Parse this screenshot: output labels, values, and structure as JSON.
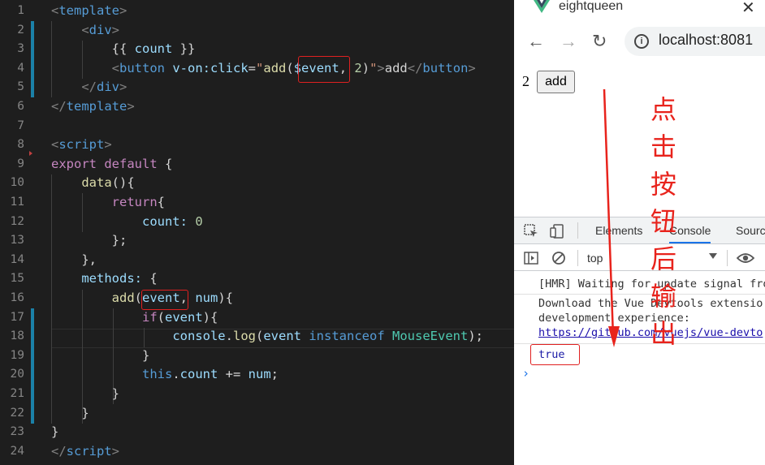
{
  "editor": {
    "line_numbers": [
      "1",
      "2",
      "3",
      "4",
      "5",
      "6",
      "7",
      "8",
      "9",
      "10",
      "11",
      "12",
      "13",
      "14",
      "15",
      "16",
      "17",
      "18",
      "19",
      "20",
      "21",
      "22",
      "23",
      "24"
    ],
    "lines": [
      [
        [
          "t-gray",
          "<"
        ],
        [
          "t-tag",
          "template"
        ],
        [
          "t-gray",
          ">"
        ]
      ],
      [
        [
          "t-pl",
          "    "
        ],
        [
          "t-gray",
          "<"
        ],
        [
          "t-tag",
          "div"
        ],
        [
          "t-gray",
          ">"
        ]
      ],
      [
        [
          "t-pl",
          "        {{ "
        ],
        [
          "t-var",
          "count"
        ],
        [
          "t-pl",
          " }}"
        ]
      ],
      [
        [
          "t-pl",
          "        "
        ],
        [
          "t-gray",
          "<"
        ],
        [
          "t-tag",
          "button"
        ],
        [
          "t-pl",
          " "
        ],
        [
          "t-attr",
          "v-on:click"
        ],
        [
          "t-pl",
          "="
        ],
        [
          "t-str",
          "\""
        ],
        [
          "t-fn",
          "add"
        ],
        [
          "t-pl",
          "("
        ],
        [
          "t-var",
          "$event"
        ],
        [
          "t-pl",
          ", "
        ],
        [
          "t-num",
          "2"
        ],
        [
          "t-pl",
          ")"
        ],
        [
          "t-str",
          "\""
        ],
        [
          "t-gray",
          ">"
        ],
        [
          "t-pl",
          "add"
        ],
        [
          "t-gray",
          "</"
        ],
        [
          "t-tag",
          "button"
        ],
        [
          "t-gray",
          ">"
        ]
      ],
      [
        [
          "t-pl",
          "    "
        ],
        [
          "t-gray",
          "</"
        ],
        [
          "t-tag",
          "div"
        ],
        [
          "t-gray",
          ">"
        ]
      ],
      [
        [
          "t-gray",
          "</"
        ],
        [
          "t-tag",
          "template"
        ],
        [
          "t-gray",
          ">"
        ]
      ],
      [],
      [
        [
          "t-gray",
          "<"
        ],
        [
          "t-tag",
          "script"
        ],
        [
          "t-gray",
          ">"
        ]
      ],
      [
        [
          "t-ctl",
          "export"
        ],
        [
          "t-pl",
          " "
        ],
        [
          "t-ctl",
          "default"
        ],
        [
          "t-pl",
          " {"
        ]
      ],
      [
        [
          "t-pl",
          "    "
        ],
        [
          "t-fn",
          "data"
        ],
        [
          "t-pl",
          "(){"
        ]
      ],
      [
        [
          "t-pl",
          "        "
        ],
        [
          "t-ctl",
          "return"
        ],
        [
          "t-pl",
          "{"
        ]
      ],
      [
        [
          "t-pl",
          "            "
        ],
        [
          "t-var",
          "count"
        ],
        [
          "t-var",
          ":"
        ],
        [
          "t-pl",
          " "
        ],
        [
          "t-num",
          "0"
        ]
      ],
      [
        [
          "t-pl",
          "        };"
        ]
      ],
      [
        [
          "t-pl",
          "    },"
        ]
      ],
      [
        [
          "t-pl",
          "    "
        ],
        [
          "t-var",
          "methods"
        ],
        [
          "t-var",
          ":"
        ],
        [
          "t-pl",
          " {"
        ]
      ],
      [
        [
          "t-pl",
          "        "
        ],
        [
          "t-fn",
          "add"
        ],
        [
          "t-pl",
          "("
        ],
        [
          "t-var",
          "event"
        ],
        [
          "t-pl",
          ", "
        ],
        [
          "t-var",
          "num"
        ],
        [
          "t-pl",
          "){"
        ]
      ],
      [
        [
          "t-pl",
          "            "
        ],
        [
          "t-ctl",
          "if"
        ],
        [
          "t-pl",
          "("
        ],
        [
          "t-var",
          "event"
        ],
        [
          "t-pl",
          "){"
        ]
      ],
      [
        [
          "t-pl",
          "                "
        ],
        [
          "t-var",
          "console"
        ],
        [
          "t-pl",
          "."
        ],
        [
          "t-fn",
          "log"
        ],
        [
          "t-pl",
          "("
        ],
        [
          "t-var",
          "event"
        ],
        [
          "t-pl",
          " "
        ],
        [
          "t-kw",
          "instanceof"
        ],
        [
          "t-pl",
          " "
        ],
        [
          "t-type",
          "MouseEvent"
        ],
        [
          "t-pl",
          ");"
        ]
      ],
      [
        [
          "t-pl",
          "            }"
        ]
      ],
      [
        [
          "t-pl",
          "            "
        ],
        [
          "t-kw",
          "this"
        ],
        [
          "t-pl",
          "."
        ],
        [
          "t-var",
          "count"
        ],
        [
          "t-pl",
          " += "
        ],
        [
          "t-var",
          "num"
        ],
        [
          "t-pl",
          ";"
        ]
      ],
      [
        [
          "t-pl",
          "        }"
        ]
      ],
      [
        [
          "t-pl",
          "    }"
        ]
      ],
      [
        [
          "t-pl",
          "}"
        ]
      ],
      [
        [
          "t-gray",
          "</"
        ],
        [
          "t-tag",
          "script"
        ],
        [
          "t-gray",
          ">"
        ]
      ]
    ]
  },
  "browser": {
    "tab_title": "eightqueen",
    "tab_close": "✕",
    "nav_back": "←",
    "nav_forward": "→",
    "nav_reload": "↻",
    "info_icon": "i",
    "url": "localhost:8081",
    "page": {
      "count": "2",
      "button_label": "add"
    },
    "devtools": {
      "tabs": [
        "Elements",
        "Console",
        "Sourc"
      ],
      "active_tab": "Console",
      "context": "top",
      "console_lines": [
        "[HMR] Waiting for update signal fro",
        "Download the Vue Devtools extensio",
        "development experience:",
        "https://github.com/vuejs/vue-devto",
        "true"
      ],
      "prompt": "›"
    }
  },
  "annotation": {
    "text": "点击按钮后输出",
    "color": "#e8231c"
  }
}
